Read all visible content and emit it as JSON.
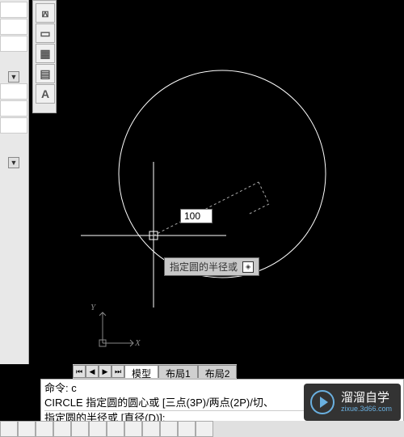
{
  "left_panel": {
    "items": [
      "",
      "",
      "",
      "",
      "",
      ""
    ]
  },
  "toolbar": {
    "tools": [
      {
        "name": "crop-icon",
        "glyph": "⟎"
      },
      {
        "name": "rect-icon",
        "glyph": "▭"
      },
      {
        "name": "grid-icon",
        "glyph": "▦"
      },
      {
        "name": "table-icon",
        "glyph": "▤"
      },
      {
        "name": "text-icon",
        "glyph": "A"
      }
    ]
  },
  "input": {
    "value": "100"
  },
  "tooltip": {
    "text": "指定圆的半径或"
  },
  "tabs": {
    "items": [
      {
        "label": "模型",
        "active": true
      },
      {
        "label": "布局1",
        "active": false
      },
      {
        "label": "布局2",
        "active": false
      }
    ]
  },
  "ucs": {
    "x_label": "X",
    "y_label": "Y"
  },
  "command": {
    "line1": "命令: c",
    "line2": "CIRCLE 指定圆的圆心或 [三点(3P)/两点(2P)/切、",
    "line3": "指定圆的半径或 [直径(D)]:"
  },
  "watermark": {
    "title": "溜溜自学",
    "subtitle": "zixue.3d66.com"
  },
  "colors": {
    "circle": "#ffffff",
    "crosshair": "#ffffff",
    "rubber_band": "#aaaaaa"
  }
}
